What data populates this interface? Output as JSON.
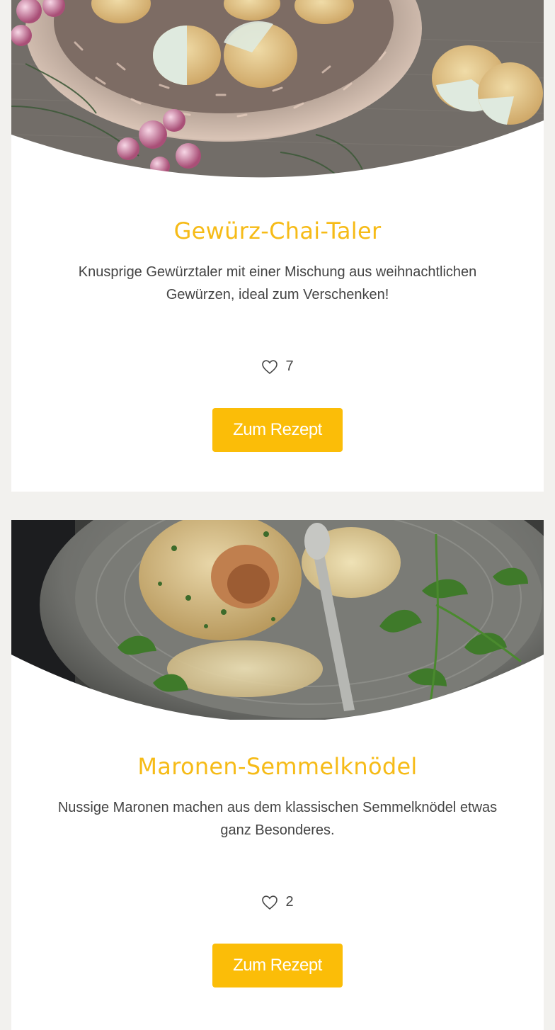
{
  "recipes": [
    {
      "image_icon": "cookies-photo",
      "title": "Gewürz-Chai-Taler",
      "description": "Knusprige Gewürztaler mit einer Mischung aus weihnachtlichen Gewürzen, ideal zum Verschenken!",
      "likes": "7",
      "button_label": "Zum Rezept"
    },
    {
      "image_icon": "dumpling-photo",
      "title": "Maronen-Semmelknödel",
      "description": "Nussige Maronen machen aus dem klassischen Semmelknödel etwas ganz Besonderes.",
      "likes": "2",
      "button_label": "Zum Rezept"
    }
  ],
  "colors": {
    "accent": "#f6bb17",
    "button": "#fbbd08",
    "background": "#f2f1ee",
    "text": "#444444"
  }
}
